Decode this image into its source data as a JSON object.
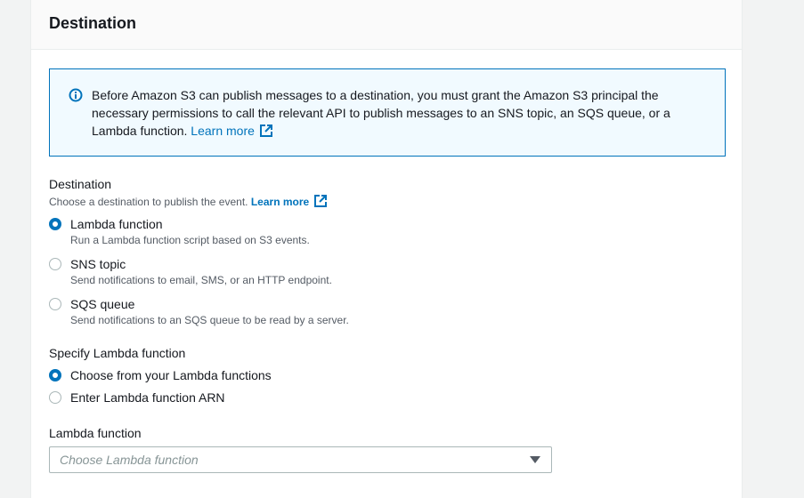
{
  "panel": {
    "title": "Destination"
  },
  "info": {
    "text": "Before Amazon S3 can publish messages to a destination, you must grant the Amazon S3 principal the necessary permissions to call the relevant API to publish messages to an SNS topic, an SQS queue, or a Lambda function.",
    "link_label": "Learn more"
  },
  "destination": {
    "label": "Destination",
    "description": "Choose a destination to publish the event.",
    "link_label": "Learn more",
    "options": [
      {
        "label": "Lambda function",
        "description": "Run a Lambda function script based on S3 events.",
        "selected": true
      },
      {
        "label": "SNS topic",
        "description": "Send notifications to email, SMS, or an HTTP endpoint.",
        "selected": false
      },
      {
        "label": "SQS queue",
        "description": "Send notifications to an SQS queue to be read by a server.",
        "selected": false
      }
    ]
  },
  "specify": {
    "label": "Specify Lambda function",
    "options": [
      {
        "label": "Choose from your Lambda functions",
        "selected": true
      },
      {
        "label": "Enter Lambda function ARN",
        "selected": false
      }
    ]
  },
  "lambda_select": {
    "label": "Lambda function",
    "placeholder": "Choose Lambda function"
  },
  "colors": {
    "accent": "#0073bb",
    "info_bg": "#f1faff",
    "panel_header_bg": "#fafafa"
  }
}
